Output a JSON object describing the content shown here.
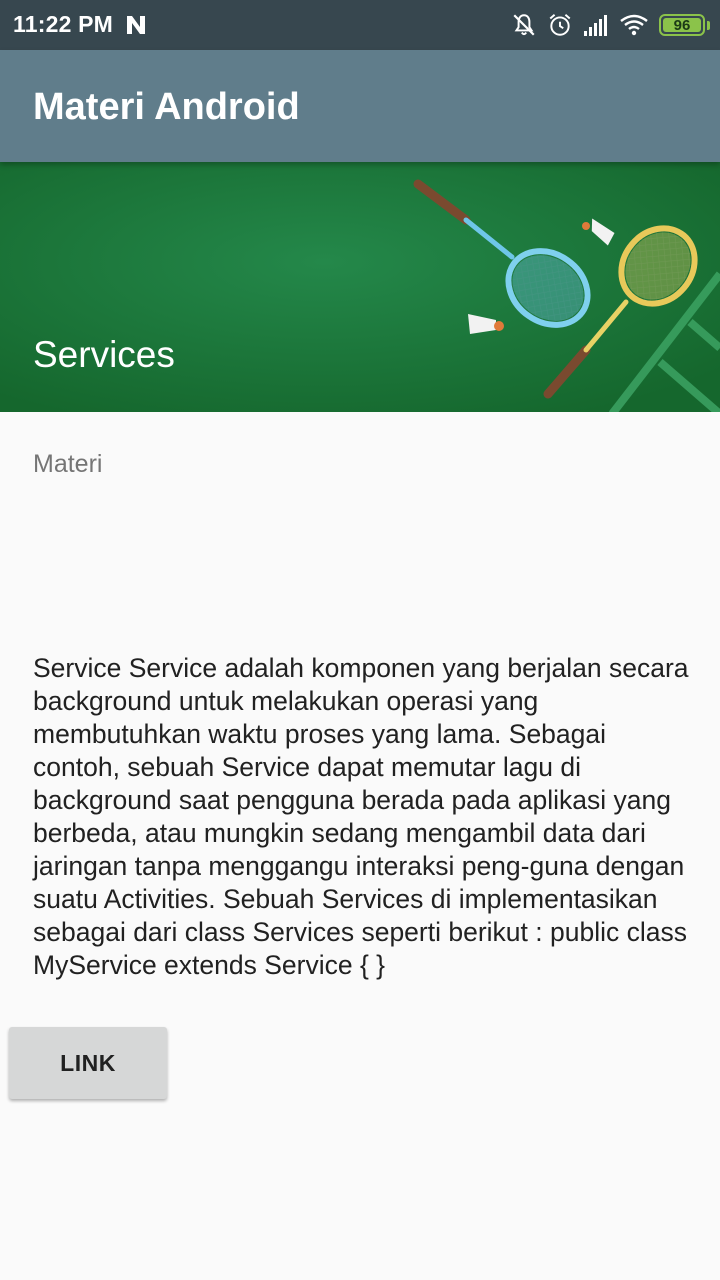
{
  "status_bar": {
    "time": "11:22 PM",
    "notification_icon": "n-app-icon",
    "icons": [
      "muted-bell-icon",
      "alarm-icon",
      "signal-icon",
      "wifi-icon"
    ],
    "battery_level": "96"
  },
  "app_bar": {
    "title": "Materi Android",
    "color": "#607d8b"
  },
  "header": {
    "title": "Services",
    "image": "badminton-rackets-illustration"
  },
  "content": {
    "section_label": "Materi",
    "body": "Service Service adalah komponen yang berjalan secara background untuk melakukan operasi yang membutuhkan waktu proses yang lama. Sebagai contoh, sebuah Service dapat memutar lagu di background saat pengguna berada pada aplikasi yang berbeda, atau mungkin sedang mengambil data dari jaringan tanpa menggangu interaksi peng-guna dengan suatu Activities. Sebuah Services di implementasikan sebagai dari class Services seperti berikut : public class MyService extends Service { }"
  },
  "actions": {
    "link_label": "LINK"
  }
}
